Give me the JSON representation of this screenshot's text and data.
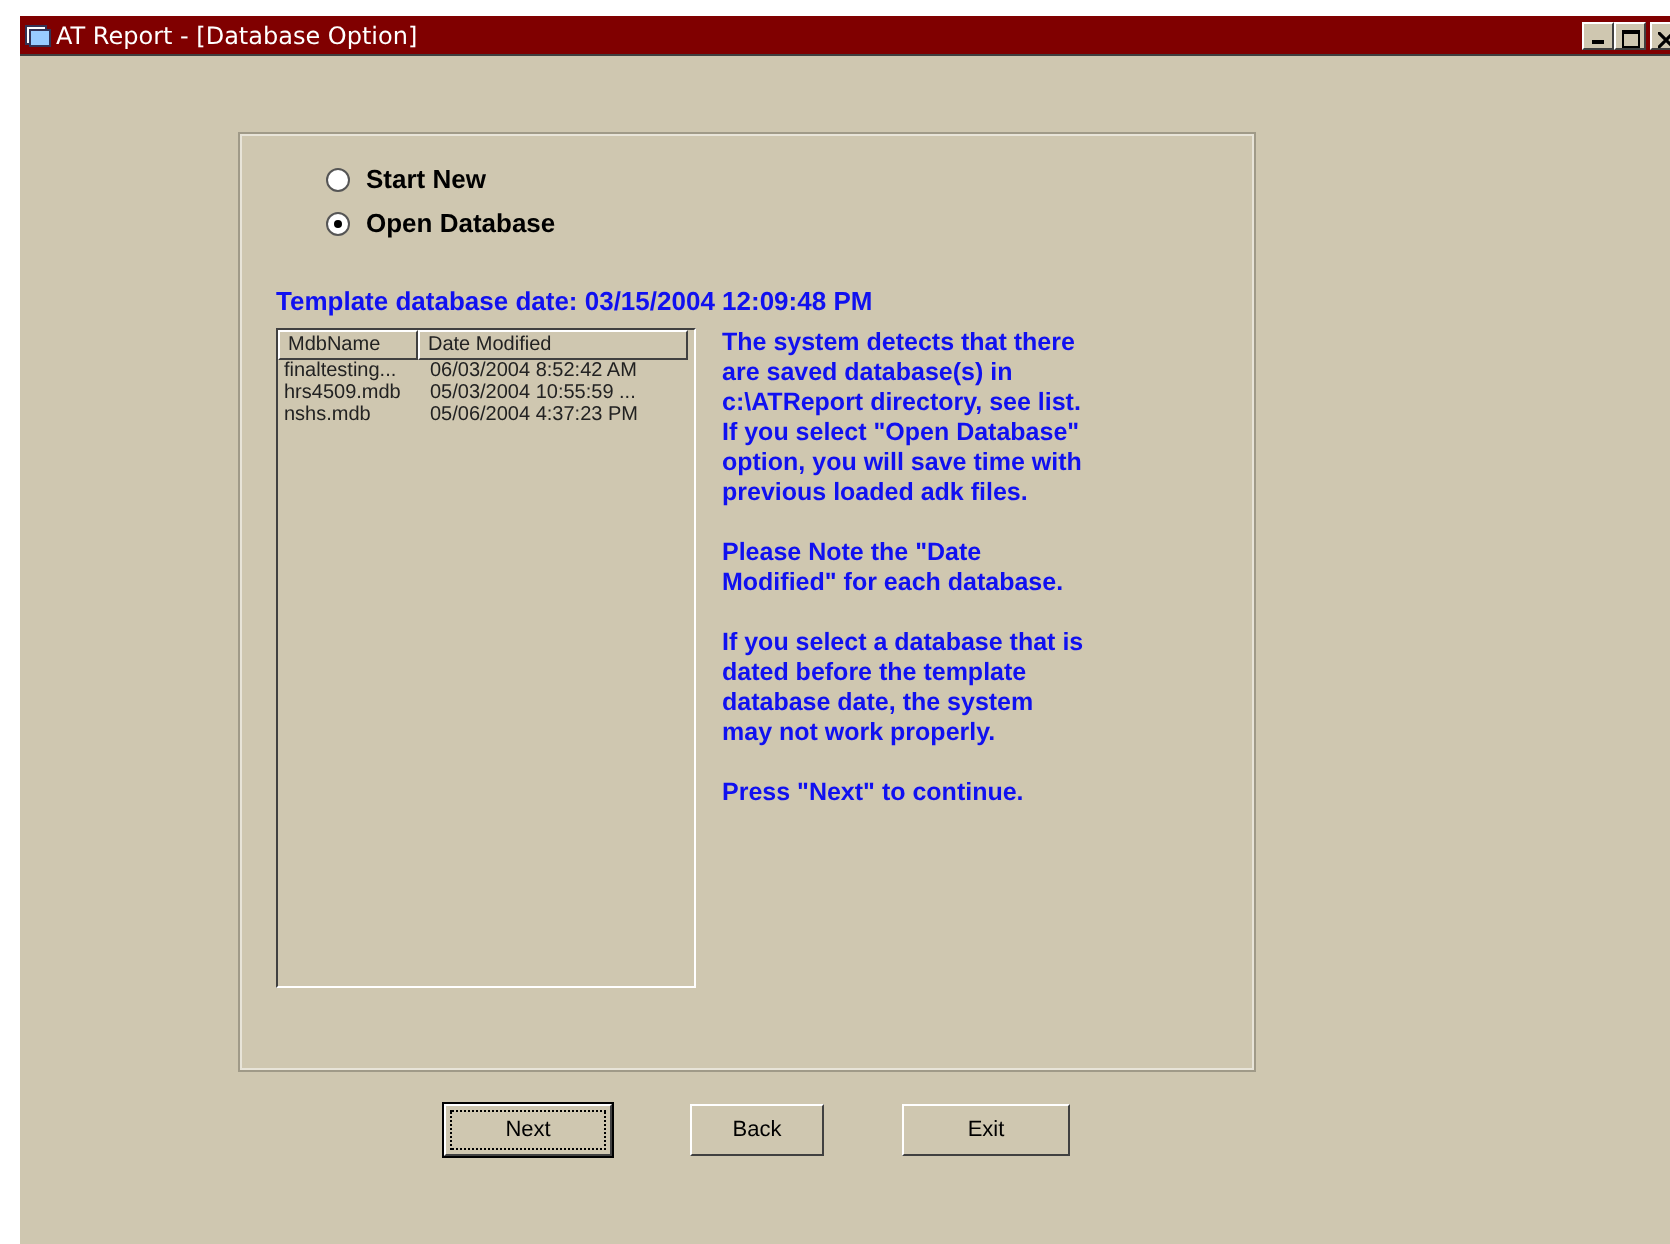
{
  "window": {
    "title": "AT Report - [Database Option]"
  },
  "options": [
    {
      "label": "Start New",
      "selected": false
    },
    {
      "label": "Open Database",
      "selected": true
    }
  ],
  "template_date": "Template database date: 03/15/2004 12:09:48 PM",
  "list": {
    "columns": [
      "MdbName",
      "Date Modified"
    ],
    "rows": [
      [
        "finaltesting...",
        "06/03/2004 8:52:42 AM"
      ],
      [
        "hrs4509.mdb",
        "05/03/2004 10:55:59 ..."
      ],
      [
        "nshs.mdb",
        "05/06/2004 4:37:23 PM"
      ]
    ]
  },
  "paragraphs": [
    [
      "The system detects that there",
      "are saved database(s) in",
      "c:\\ATReport directory, see list.",
      "If you select \"Open Database\"",
      "option, you will save time with",
      "previous loaded adk files."
    ],
    [
      "Please Note the \"Date",
      "Modified\" for each database."
    ],
    [
      "If you select a database that is",
      "dated before the template",
      "database date, the system",
      "may not work properly."
    ],
    [
      "Press \"Next\" to continue."
    ]
  ],
  "buttons": [
    {
      "label": "Next",
      "focused": true
    },
    {
      "label": "Back",
      "focused": false
    },
    {
      "label": "Exit",
      "focused": false
    }
  ]
}
